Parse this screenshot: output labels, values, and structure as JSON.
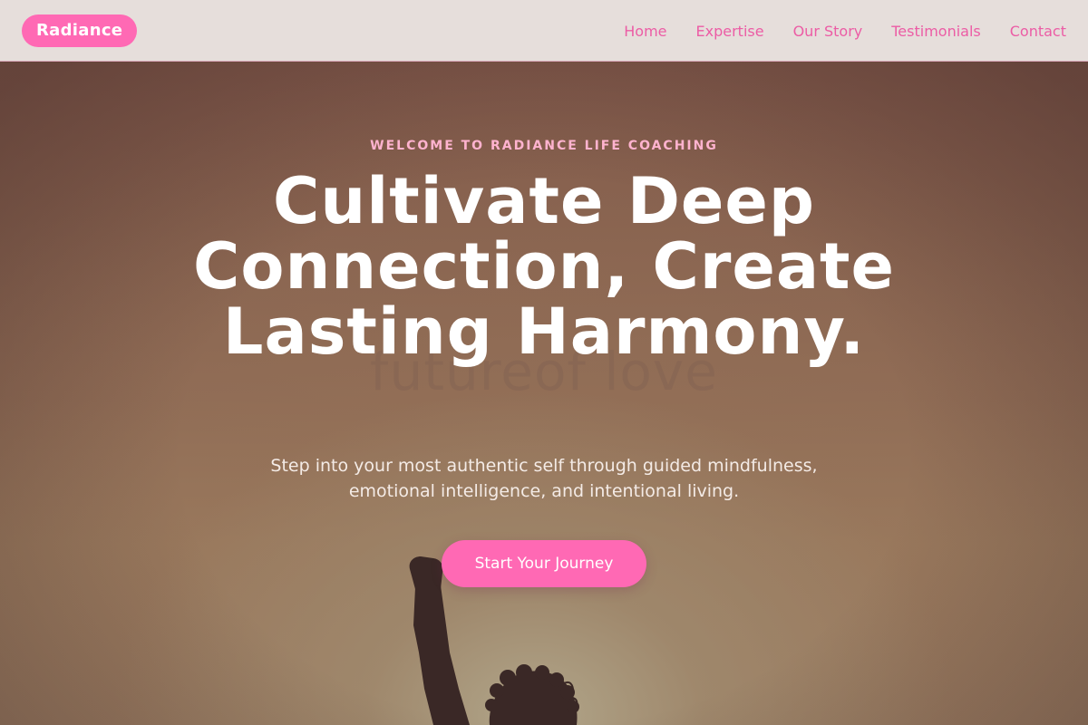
{
  "brand": {
    "label": "Radiance"
  },
  "nav": {
    "items": [
      {
        "label": "Home"
      },
      {
        "label": "Expertise"
      },
      {
        "label": "Our Story"
      },
      {
        "label": "Testimonials"
      },
      {
        "label": "Contact"
      }
    ]
  },
  "hero": {
    "eyebrow": "WELCOME TO RADIANCE LIFE COACHING",
    "headline": "Cultivate Deep Connection, Create Lasting Harmony.",
    "subheadline": "Step into your most authentic self through guided mindfulness, emotional intelligence, and intentional living.",
    "cta_label": "Start Your Journey",
    "watermark": "futureof love"
  },
  "colors": {
    "accent": "#ff69b4",
    "nav_text": "#ec5ca5",
    "navbar_bg": "#e6dedb",
    "eyebrow": "#ffb3cf",
    "headline": "#ffffff"
  },
  "icons": {
    "hero_image": "person-raised-fist-silhouette"
  }
}
